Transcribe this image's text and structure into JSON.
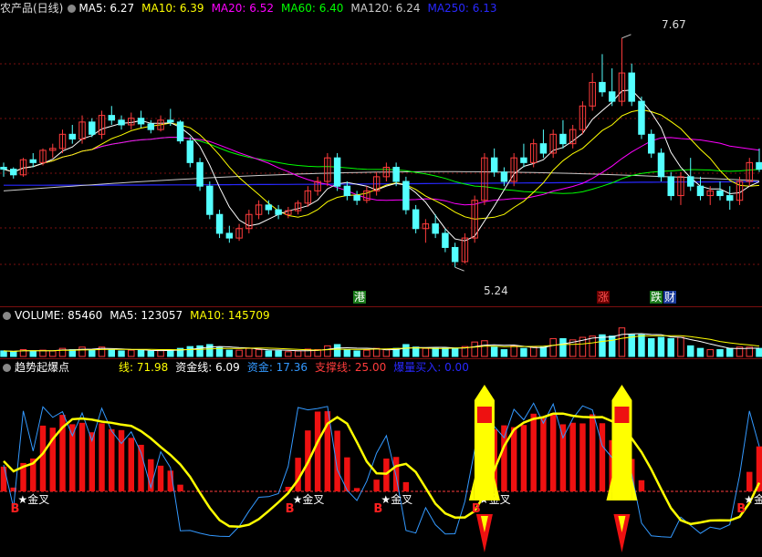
{
  "colors": {
    "up": "#ff3c3c",
    "down": "#54ffff",
    "ma5": "#ffffff",
    "ma10": "#ffff00",
    "ma20": "#ff00ff",
    "ma60": "#00ff00",
    "ma120": "#cccccc",
    "ma250": "#2828ff",
    "grid": "#7a1010",
    "gold": "#ffff00",
    "blue": "#3399ff"
  },
  "price_panel": {
    "title": "农产品(日线)",
    "ma_labels": [
      {
        "label": "MA5: 6.27",
        "color": "#ffffff"
      },
      {
        "label": "MA10: 6.39",
        "color": "#ffff00"
      },
      {
        "label": "MA20: 6.52",
        "color": "#ff00ff"
      },
      {
        "label": "MA60: 6.40",
        "color": "#00ff00"
      },
      {
        "label": "MA120: 6.24",
        "color": "#cccccc"
      },
      {
        "label": "MA250: 6.13",
        "color": "#2828ff"
      }
    ],
    "high_label": "7.67",
    "low_label": "5.24",
    "event_tags": [
      {
        "text": "港",
        "bg": "#1a7a1a",
        "color": "#ffffff"
      },
      {
        "text": "涨",
        "bg": "#6a0000",
        "color": "#ff5050"
      },
      {
        "text": "跌",
        "bg": "#1a7a1a",
        "color": "#ffffff"
      },
      {
        "text": "财",
        "bg": "#1a3a9a",
        "color": "#ffffff"
      }
    ]
  },
  "volume_panel": {
    "labels": [
      {
        "label": "VOLUME: 85460",
        "color": "#ffffff"
      },
      {
        "label": "MA5: 123057",
        "color": "#ffffff"
      },
      {
        "label": "MA10: 145709",
        "color": "#ffff00"
      }
    ]
  },
  "indicator_panel": {
    "title": "趋势起爆点",
    "labels": [
      {
        "label": "线: 71.98",
        "color": "#ffff00"
      },
      {
        "label": "资金线: 6.09",
        "color": "#ffffff"
      },
      {
        "label": "资金: 17.36",
        "color": "#3399ff"
      },
      {
        "label": "支撑线: 25.00",
        "color": "#ff3c3c"
      },
      {
        "label": "爆量买入: 0.00",
        "color": "#2828ff"
      }
    ],
    "golden_cross_label": "★金叉",
    "buy_label": "B"
  },
  "chart_data": {
    "type": "candlestick",
    "high": 7.67,
    "low": 5.24,
    "bars": [
      [
        6.3,
        6.35,
        6.2,
        6.28
      ],
      [
        6.28,
        6.3,
        6.18,
        6.22
      ],
      [
        6.22,
        6.4,
        6.2,
        6.38
      ],
      [
        6.38,
        6.45,
        6.3,
        6.35
      ],
      [
        6.35,
        6.5,
        6.32,
        6.48
      ],
      [
        6.48,
        6.55,
        6.4,
        6.5
      ],
      [
        6.5,
        6.7,
        6.45,
        6.65
      ],
      [
        6.65,
        6.75,
        6.55,
        6.6
      ],
      [
        6.6,
        6.85,
        6.55,
        6.78
      ],
      [
        6.78,
        6.82,
        6.62,
        6.65
      ],
      [
        6.65,
        6.9,
        6.6,
        6.85
      ],
      [
        6.85,
        6.95,
        6.75,
        6.8
      ],
      [
        6.8,
        6.85,
        6.7,
        6.75
      ],
      [
        6.75,
        6.88,
        6.7,
        6.82
      ],
      [
        6.82,
        6.9,
        6.72,
        6.76
      ],
      [
        6.76,
        6.8,
        6.66,
        6.7
      ],
      [
        6.7,
        6.85,
        6.68,
        6.8
      ],
      [
        6.8,
        6.92,
        6.74,
        6.78
      ],
      [
        6.78,
        6.8,
        6.55,
        6.58
      ],
      [
        6.58,
        6.62,
        6.3,
        6.35
      ],
      [
        6.35,
        6.4,
        6.05,
        6.1
      ],
      [
        6.1,
        6.15,
        5.75,
        5.8
      ],
      [
        5.8,
        5.85,
        5.55,
        5.6
      ],
      [
        5.6,
        5.68,
        5.5,
        5.55
      ],
      [
        5.55,
        5.7,
        5.52,
        5.65
      ],
      [
        5.65,
        5.85,
        5.6,
        5.8
      ],
      [
        5.8,
        5.95,
        5.75,
        5.9
      ],
      [
        5.9,
        5.95,
        5.8,
        5.85
      ],
      [
        5.85,
        5.9,
        5.75,
        5.8
      ],
      [
        5.8,
        5.88,
        5.76,
        5.84
      ],
      [
        5.84,
        5.95,
        5.8,
        5.92
      ],
      [
        5.92,
        6.1,
        5.88,
        6.05
      ],
      [
        6.05,
        6.2,
        6.0,
        6.15
      ],
      [
        6.15,
        6.45,
        6.1,
        6.4
      ],
      [
        6.4,
        6.45,
        6.05,
        6.1
      ],
      [
        6.1,
        6.15,
        5.95,
        6.0
      ],
      [
        6.0,
        6.05,
        5.9,
        5.95
      ],
      [
        5.95,
        6.1,
        5.92,
        6.05
      ],
      [
        6.05,
        6.25,
        6.0,
        6.2
      ],
      [
        6.2,
        6.35,
        6.15,
        6.3
      ],
      [
        6.3,
        6.35,
        6.1,
        6.15
      ],
      [
        6.15,
        6.2,
        5.8,
        5.85
      ],
      [
        5.85,
        5.9,
        5.6,
        5.65
      ],
      [
        5.65,
        5.75,
        5.5,
        5.7
      ],
      [
        5.7,
        5.8,
        5.55,
        5.6
      ],
      [
        5.6,
        5.65,
        5.4,
        5.45
      ],
      [
        5.45,
        5.5,
        5.24,
        5.3
      ],
      [
        5.3,
        5.6,
        5.28,
        5.55
      ],
      [
        5.55,
        6.0,
        5.5,
        5.95
      ],
      [
        5.95,
        6.45,
        5.9,
        6.4
      ],
      [
        6.4,
        6.5,
        6.2,
        6.25
      ],
      [
        6.25,
        6.3,
        6.1,
        6.15
      ],
      [
        6.15,
        6.45,
        6.1,
        6.4
      ],
      [
        6.4,
        6.55,
        6.3,
        6.35
      ],
      [
        6.35,
        6.6,
        6.3,
        6.55
      ],
      [
        6.55,
        6.7,
        6.4,
        6.45
      ],
      [
        6.45,
        6.7,
        6.4,
        6.65
      ],
      [
        6.65,
        6.8,
        6.5,
        6.55
      ],
      [
        6.55,
        6.75,
        6.5,
        6.7
      ],
      [
        6.7,
        7.0,
        6.65,
        6.95
      ],
      [
        6.95,
        7.3,
        6.9,
        7.2
      ],
      [
        7.2,
        7.5,
        7.05,
        7.1
      ],
      [
        7.1,
        7.35,
        6.95,
        7.0
      ],
      [
        7.0,
        7.67,
        6.95,
        7.3
      ],
      [
        7.3,
        7.4,
        6.95,
        7.0
      ],
      [
        7.0,
        7.05,
        6.6,
        6.65
      ],
      [
        6.65,
        6.7,
        6.4,
        6.45
      ],
      [
        6.45,
        6.5,
        6.15,
        6.2
      ],
      [
        6.2,
        6.25,
        5.95,
        6.0
      ],
      [
        6.0,
        6.25,
        5.9,
        6.2
      ],
      [
        6.2,
        6.4,
        6.05,
        6.1
      ],
      [
        6.1,
        6.2,
        5.95,
        6.0
      ],
      [
        6.0,
        6.1,
        5.9,
        6.05
      ],
      [
        6.05,
        6.15,
        5.95,
        6.0
      ],
      [
        6.0,
        6.1,
        5.85,
        5.95
      ],
      [
        5.95,
        6.2,
        5.9,
        6.15
      ],
      [
        6.15,
        6.4,
        6.1,
        6.35
      ],
      [
        6.35,
        6.5,
        6.25,
        6.28
      ]
    ]
  }
}
